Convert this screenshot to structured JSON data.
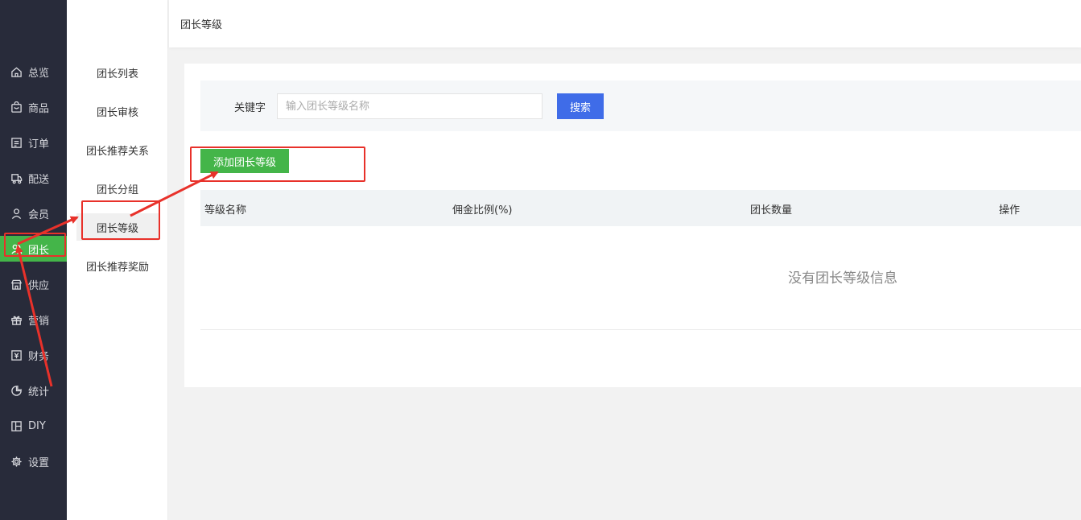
{
  "nav": {
    "items": [
      {
        "label": "总览",
        "icon": "home-icon"
      },
      {
        "label": "商品",
        "icon": "shopping-bag-icon"
      },
      {
        "label": "订单",
        "icon": "order-list-icon"
      },
      {
        "label": "配送",
        "icon": "delivery-icon"
      },
      {
        "label": "会员",
        "icon": "user-icon"
      },
      {
        "label": "团长",
        "icon": "group-leader-icon",
        "active": true
      },
      {
        "label": "供应",
        "icon": "store-icon"
      },
      {
        "label": "营销",
        "icon": "gift-icon"
      },
      {
        "label": "财务",
        "icon": "finance-icon"
      },
      {
        "label": "统计",
        "icon": "pie-chart-icon"
      },
      {
        "label": "DIY",
        "icon": "layout-icon"
      },
      {
        "label": "设置",
        "icon": "gear-icon"
      }
    ]
  },
  "subnav": {
    "items": [
      {
        "label": "团长列表"
      },
      {
        "label": "团长审核"
      },
      {
        "label": "团长推荐关系"
      },
      {
        "label": "团长分组"
      },
      {
        "label": "团长等级",
        "active": true
      },
      {
        "label": "团长推荐奖励"
      }
    ]
  },
  "header": {
    "breadcrumb": "团长等级"
  },
  "search": {
    "label": "关键字",
    "placeholder": "输入团长等级名称",
    "value": "",
    "button": "搜索"
  },
  "actions": {
    "add_button": "添加团长等级"
  },
  "table": {
    "columns": [
      "等级名称",
      "佣金比例(%)",
      "团长数量",
      "操作"
    ],
    "rows": [],
    "empty_text": "没有团长等级信息"
  },
  "colors": {
    "nav_bg": "#282b3a",
    "active_green": "#44b549",
    "primary_blue": "#3f6ce8",
    "annotation_red": "#e8312a"
  }
}
